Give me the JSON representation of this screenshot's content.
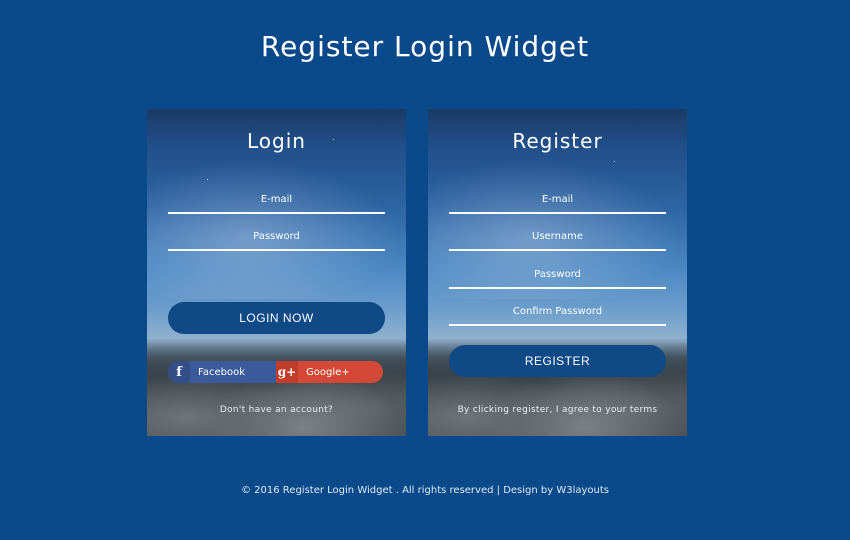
{
  "page": {
    "title": "Register Login Widget"
  },
  "login": {
    "title": "Login",
    "email_label": "E-mail",
    "password_label": "Password",
    "button_label": "LOGIN NOW",
    "facebook_icon": "f",
    "facebook_label": "Facebook",
    "google_icon": "g+",
    "google_label": "Google+",
    "account_note": "Don't have an account?"
  },
  "register": {
    "title": "Register",
    "email_label": "E-mail",
    "username_label": "Username",
    "password_label": "Password",
    "confirm_label": "Confirm Password",
    "button_label": "REGISTER",
    "terms_note": "By clicking register, I agree to your terms"
  },
  "footer": {
    "text": "© 2016 Register Login Widget . All rights reserved | Design by W3layouts"
  },
  "colors": {
    "background": "#0b4a8a",
    "button": "#0f4a87",
    "facebook": "#3b5a9b",
    "google": "#d34836"
  },
  "icons": {
    "facebook": "facebook-icon",
    "google": "google-plus-icon"
  }
}
